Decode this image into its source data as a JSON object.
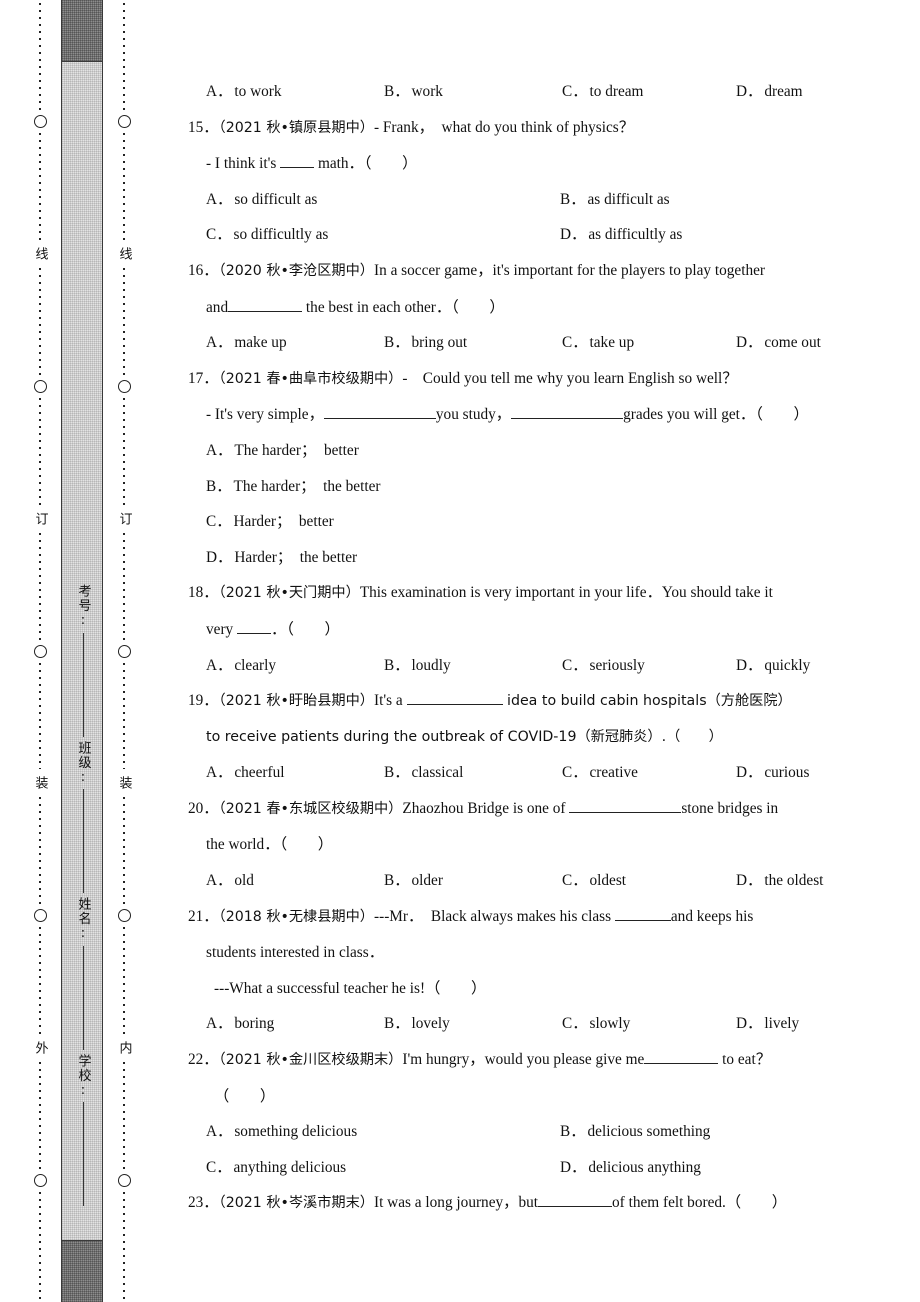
{
  "seal_margin": {
    "outer_rail_chars": [
      "线",
      "订",
      "装",
      "外"
    ],
    "inner_rail_chars": [
      "线",
      "订",
      "装",
      "内"
    ],
    "info_fields": [
      {
        "label": "学校:"
      },
      {
        "label": "姓名:"
      },
      {
        "label": "班级:"
      },
      {
        "label": "考号:"
      }
    ]
  },
  "questions": [
    {
      "id": "q14-options",
      "options": [
        {
          "mark": "A．",
          "text": "to work"
        },
        {
          "mark": "B．",
          "text": "work"
        },
        {
          "mark": "C．",
          "text": "to dream"
        },
        {
          "mark": "D．",
          "text": "dream"
        }
      ]
    },
    {
      "id": "q15",
      "number": "15．",
      "source": "（2021 秋•镇原县期中）",
      "stem": "‑ Frank，　what do you think of physics？",
      "line2_pre": "‑ I think it's ",
      "line2_post": " math．（　　）",
      "options": [
        {
          "mark": "A．",
          "text": "so difficult as"
        },
        {
          "mark": "B．",
          "text": "as difficult as"
        },
        {
          "mark": "C．",
          "text": "so difficultly as"
        },
        {
          "mark": "D．",
          "text": "as difficultly as"
        }
      ]
    },
    {
      "id": "q16",
      "number": "16．",
      "source": "（2020 秋•李沧区期中）",
      "stem": "In a soccer game，it's important for the players to play together",
      "line2_pre": "and",
      "line2_post": " the best in each other．（　　）",
      "options": [
        {
          "mark": "A．",
          "text": "make up"
        },
        {
          "mark": "B．",
          "text": "bring out"
        },
        {
          "mark": "C．",
          "text": "take up"
        },
        {
          "mark": "D．",
          "text": "come out"
        }
      ]
    },
    {
      "id": "q17",
      "number": "17．",
      "source": "（2021 春•曲阜市校级期中）",
      "stem": "‑　Could you tell me why you learn English so well？",
      "line2_a": "‑ It's very simple，",
      "line2_b": "you study，",
      "line2_c": "grades you will get．（　　）",
      "options": [
        {
          "mark": "A．",
          "text": "The harder；　better"
        },
        {
          "mark": "B．",
          "text": "The harder；　the better"
        },
        {
          "mark": "C．",
          "text": "Harder；　better"
        },
        {
          "mark": "D．",
          "text": "Harder；　the better"
        }
      ]
    },
    {
      "id": "q18",
      "number": "18．",
      "source": "（2021 秋•天门期中）",
      "stem": "This examination is very important in your life．You should take it",
      "line2_pre": "very ",
      "line2_post": "．（　　）",
      "options": [
        {
          "mark": "A．",
          "text": "clearly"
        },
        {
          "mark": "B．",
          "text": "loudly"
        },
        {
          "mark": "C．",
          "text": "seriously"
        },
        {
          "mark": "D．",
          "text": "quickly"
        }
      ]
    },
    {
      "id": "q19",
      "number": "19．",
      "source": "（2021 秋•盱眙县期中）",
      "stem_pre": "It's a ",
      "stem_post": " idea to build cabin hospitals（方舱医院）",
      "line2": "to receive patients during the outbreak of COVID‑19（新冠肺炎）.（　　）",
      "options": [
        {
          "mark": "A．",
          "text": "cheerful"
        },
        {
          "mark": "B．",
          "text": "classical"
        },
        {
          "mark": "C．",
          "text": "creative"
        },
        {
          "mark": "D．",
          "text": "curious"
        }
      ]
    },
    {
      "id": "q20",
      "number": "20．",
      "source": "（2021 春•东城区校级期中）",
      "stem_pre": "Zhaozhou Bridge is one of ",
      "stem_post": "stone bridges in",
      "line2": "the world．（　　）",
      "options": [
        {
          "mark": "A．",
          "text": "old"
        },
        {
          "mark": "B．",
          "text": "older"
        },
        {
          "mark": "C．",
          "text": "oldest"
        },
        {
          "mark": "D．",
          "text": "the oldest"
        }
      ]
    },
    {
      "id": "q21",
      "number": "21．",
      "source": "（2018 秋•无棣县期中）",
      "stem_pre": "‑‑‑Mr．　Black always makes his class ",
      "stem_post": "and keeps his",
      "line2": "students interested in class．",
      "line3": "‑‑‑What a successful teacher he is!（　　）",
      "options": [
        {
          "mark": "A．",
          "text": "boring"
        },
        {
          "mark": "B．",
          "text": "lovely"
        },
        {
          "mark": "C．",
          "text": "slowly"
        },
        {
          "mark": "D．",
          "text": "lively"
        }
      ]
    },
    {
      "id": "q22",
      "number": "22．",
      "source": "（2021 秋•金川区校级期末）",
      "stem_pre": "I'm hungry，would you please give me",
      "stem_post": " to eat？",
      "line2": "（　　）",
      "options": [
        {
          "mark": "A．",
          "text": "something delicious"
        },
        {
          "mark": "B．",
          "text": "delicious something"
        },
        {
          "mark": "C．",
          "text": "anything delicious"
        },
        {
          "mark": "D．",
          "text": "delicious anything"
        }
      ]
    },
    {
      "id": "q23",
      "number": "23．",
      "source": "（2021 秋•岑溪市期末）",
      "stem_pre": "It was a long journey，but",
      "stem_post": "of them felt bored.（　　）"
    }
  ]
}
